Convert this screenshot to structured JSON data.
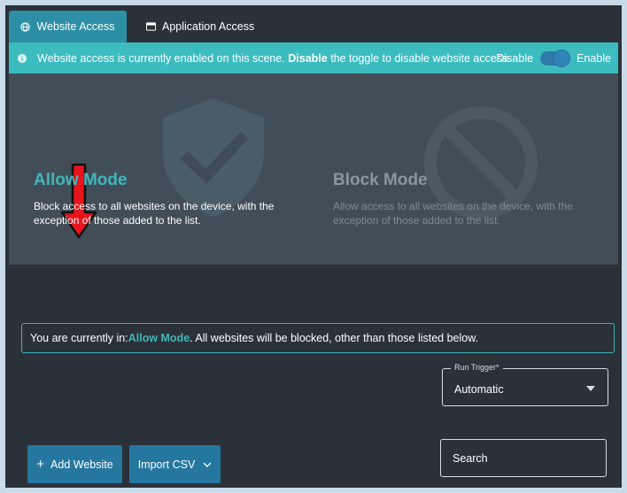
{
  "tabs": [
    {
      "label": "Website Access",
      "icon": "globe-icon",
      "active": true
    },
    {
      "label": "Application Access",
      "icon": "window-icon",
      "active": false
    }
  ],
  "banner": {
    "text_before": "Website access is currently enabled on this scene. ",
    "text_bold": "Disable",
    "text_after": " the toggle to disable website access.",
    "toggle_off_label": "Disable",
    "toggle_on_label": "Enable",
    "toggle_enabled": true
  },
  "modes": {
    "allow": {
      "title": "Allow Mode",
      "description": "Block access to all websites on the device, with the exception of those added to the list.",
      "icon": "shield-check-icon"
    },
    "block": {
      "title": "Block Mode",
      "description": "Allow access to all websites on the device, with the exception of those added to the list.",
      "icon": "no-entry-icon"
    }
  },
  "status": {
    "prefix": "You are currently in: ",
    "mode": "Allow Mode",
    "suffix": ". All websites will be blocked, other than those listed below."
  },
  "trigger": {
    "label": "Run Trigger*",
    "value": "Automatic"
  },
  "buttons": {
    "add_website": "Add Website",
    "import_csv": "Import CSV"
  },
  "search": {
    "placeholder": "Search"
  },
  "colors": {
    "accent": "#3cbcbf",
    "tab_active": "#2d8fa5",
    "button": "#2577a0",
    "background": "#2b3138",
    "annotation_arrow": "#e8141b"
  }
}
